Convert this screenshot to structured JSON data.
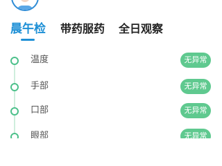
{
  "tabs": [
    {
      "label": "晨午检",
      "active": true
    },
    {
      "label": "带药服药",
      "active": false
    },
    {
      "label": "全日观察",
      "active": false
    }
  ],
  "checks": [
    {
      "label": "温度",
      "status": "无异常"
    },
    {
      "label": "手部",
      "status": "无异常"
    },
    {
      "label": "口部",
      "status": "无异常"
    },
    {
      "label": "眼部",
      "status": "无异常"
    }
  ],
  "colors": {
    "accent": "#1e90d6",
    "status_ok": "#5fc98f",
    "timeline": "#4cc08a"
  },
  "icons": [
    "avatar",
    "timeline-dot-icon"
  ]
}
